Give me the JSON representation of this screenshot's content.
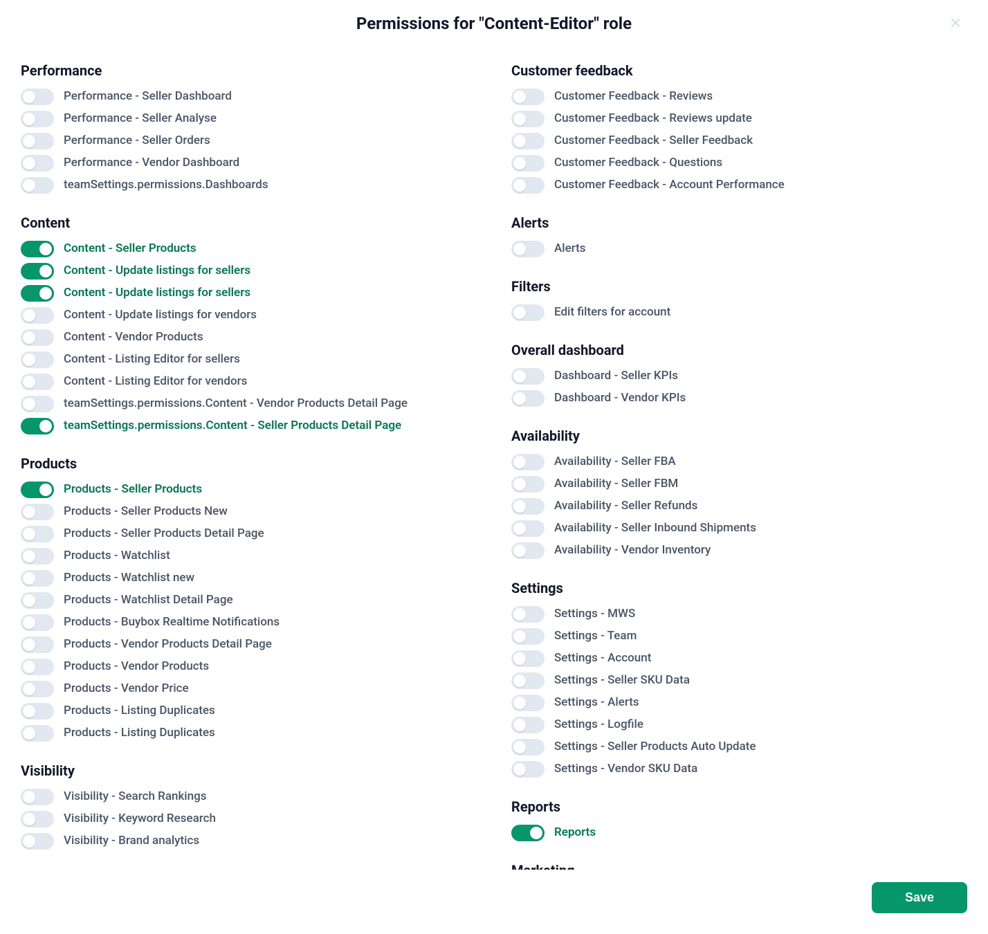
{
  "modal": {
    "title": "Permissions for \"Content-Editor\" role",
    "save_label": "Save"
  },
  "colors": {
    "accent_on": "#059669",
    "accent_text_on": "#047857",
    "toggle_off": "#e2e8f0",
    "text_muted": "#475569"
  },
  "columns": [
    {
      "groups": [
        {
          "title": "Performance",
          "items": [
            {
              "label": "Performance - Seller Dashboard",
              "on": false
            },
            {
              "label": "Performance - Seller Analyse",
              "on": false
            },
            {
              "label": "Performance - Seller Orders",
              "on": false
            },
            {
              "label": "Performance - Vendor Dashboard",
              "on": false
            },
            {
              "label": "teamSettings.permissions.Dashboards",
              "on": false
            }
          ]
        },
        {
          "title": "Content",
          "items": [
            {
              "label": "Content - Seller Products",
              "on": true
            },
            {
              "label": "Content - Update listings for sellers",
              "on": true
            },
            {
              "label": "Content - Update listings for sellers",
              "on": true
            },
            {
              "label": "Content - Update listings for vendors",
              "on": false
            },
            {
              "label": "Content - Vendor Products",
              "on": false
            },
            {
              "label": "Content - Listing Editor for sellers",
              "on": false
            },
            {
              "label": "Content - Listing Editor for vendors",
              "on": false
            },
            {
              "label": "teamSettings.permissions.Content - Vendor Products Detail Page",
              "on": false
            },
            {
              "label": "teamSettings.permissions.Content - Seller Products Detail Page",
              "on": true
            }
          ]
        },
        {
          "title": "Products",
          "items": [
            {
              "label": "Products - Seller Products",
              "on": true
            },
            {
              "label": "Products - Seller Products New",
              "on": false
            },
            {
              "label": "Products - Seller Products Detail Page",
              "on": false
            },
            {
              "label": "Products - Watchlist",
              "on": false
            },
            {
              "label": "Products - Watchlist new",
              "on": false
            },
            {
              "label": "Products - Watchlist Detail Page",
              "on": false
            },
            {
              "label": "Products - Buybox Realtime Notifications",
              "on": false
            },
            {
              "label": "Products - Vendor Products Detail Page",
              "on": false
            },
            {
              "label": "Products - Vendor Products",
              "on": false
            },
            {
              "label": "Products - Vendor Price",
              "on": false
            },
            {
              "label": "Products - Listing Duplicates",
              "on": false
            },
            {
              "label": "Products - Listing Duplicates",
              "on": false
            }
          ]
        },
        {
          "title": "Visibility",
          "items": [
            {
              "label": "Visibility - Search Rankings",
              "on": false
            },
            {
              "label": "Visibility - Keyword Research",
              "on": false
            },
            {
              "label": "Visibility - Brand analytics",
              "on": false
            }
          ]
        }
      ]
    },
    {
      "groups": [
        {
          "title": "Customer feedback",
          "items": [
            {
              "label": "Customer Feedback - Reviews",
              "on": false
            },
            {
              "label": "Customer Feedback - Reviews update",
              "on": false
            },
            {
              "label": "Customer Feedback - Seller Feedback",
              "on": false
            },
            {
              "label": "Customer Feedback - Questions",
              "on": false
            },
            {
              "label": "Customer Feedback - Account Performance",
              "on": false
            }
          ]
        },
        {
          "title": "Alerts",
          "items": [
            {
              "label": "Alerts",
              "on": false
            }
          ]
        },
        {
          "title": "Filters",
          "items": [
            {
              "label": "Edit filters for account",
              "on": false
            }
          ]
        },
        {
          "title": "Overall dashboard",
          "items": [
            {
              "label": "Dashboard - Seller KPIs",
              "on": false
            },
            {
              "label": "Dashboard - Vendor KPIs",
              "on": false
            }
          ]
        },
        {
          "title": "Availability",
          "items": [
            {
              "label": "Availability - Seller FBA",
              "on": false
            },
            {
              "label": "Availability - Seller FBM",
              "on": false
            },
            {
              "label": "Availability - Seller Refunds",
              "on": false
            },
            {
              "label": "Availability - Seller Inbound Shipments",
              "on": false
            },
            {
              "label": "Availability - Vendor Inventory",
              "on": false
            }
          ]
        },
        {
          "title": "Settings",
          "items": [
            {
              "label": "Settings - MWS",
              "on": false
            },
            {
              "label": "Settings - Team",
              "on": false
            },
            {
              "label": "Settings - Account",
              "on": false
            },
            {
              "label": "Settings - Seller SKU Data",
              "on": false
            },
            {
              "label": "Settings - Alerts",
              "on": false
            },
            {
              "label": "Settings - Logfile",
              "on": false
            },
            {
              "label": "Settings - Seller Products Auto Update",
              "on": false
            },
            {
              "label": "Settings - Vendor SKU Data",
              "on": false
            }
          ]
        },
        {
          "title": "Reports",
          "items": [
            {
              "label": "Reports",
              "on": true
            }
          ]
        },
        {
          "title": "Marketing",
          "items": []
        }
      ]
    }
  ]
}
